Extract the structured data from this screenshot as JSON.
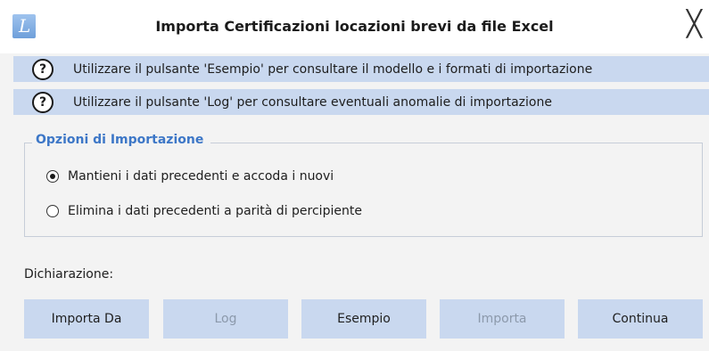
{
  "window": {
    "title": "Importa Certificazioni locazioni brevi da file Excel",
    "app_icon_letter": "L",
    "close_glyph": "╳"
  },
  "info": [
    {
      "icon": "?",
      "text": "Utilizzare il pulsante 'Esempio' per consultare il modello e i formati di importazione"
    },
    {
      "icon": "?",
      "text": "Utilizzare il pulsante 'Log' per consultare eventuali anomalie di importazione"
    }
  ],
  "options": {
    "legend": "Opzioni di Importazione",
    "items": [
      {
        "label": "Mantieni i dati precedenti e accoda i nuovi",
        "selected": true
      },
      {
        "label": "Elimina i dati precedenti a parità di percipiente",
        "selected": false
      }
    ]
  },
  "dichiarazione": {
    "label": "Dichiarazione:"
  },
  "buttons": [
    {
      "label": "Importa Da",
      "enabled": true
    },
    {
      "label": "Log",
      "enabled": false
    },
    {
      "label": "Esempio",
      "enabled": true
    },
    {
      "label": "Importa",
      "enabled": false
    },
    {
      "label": "Continua",
      "enabled": true
    }
  ],
  "colors": {
    "accent_blue": "#3d77c7",
    "info_band": "#c9d8ef",
    "background": "#f3f3f3",
    "disabled_text": "#8c99ab"
  }
}
